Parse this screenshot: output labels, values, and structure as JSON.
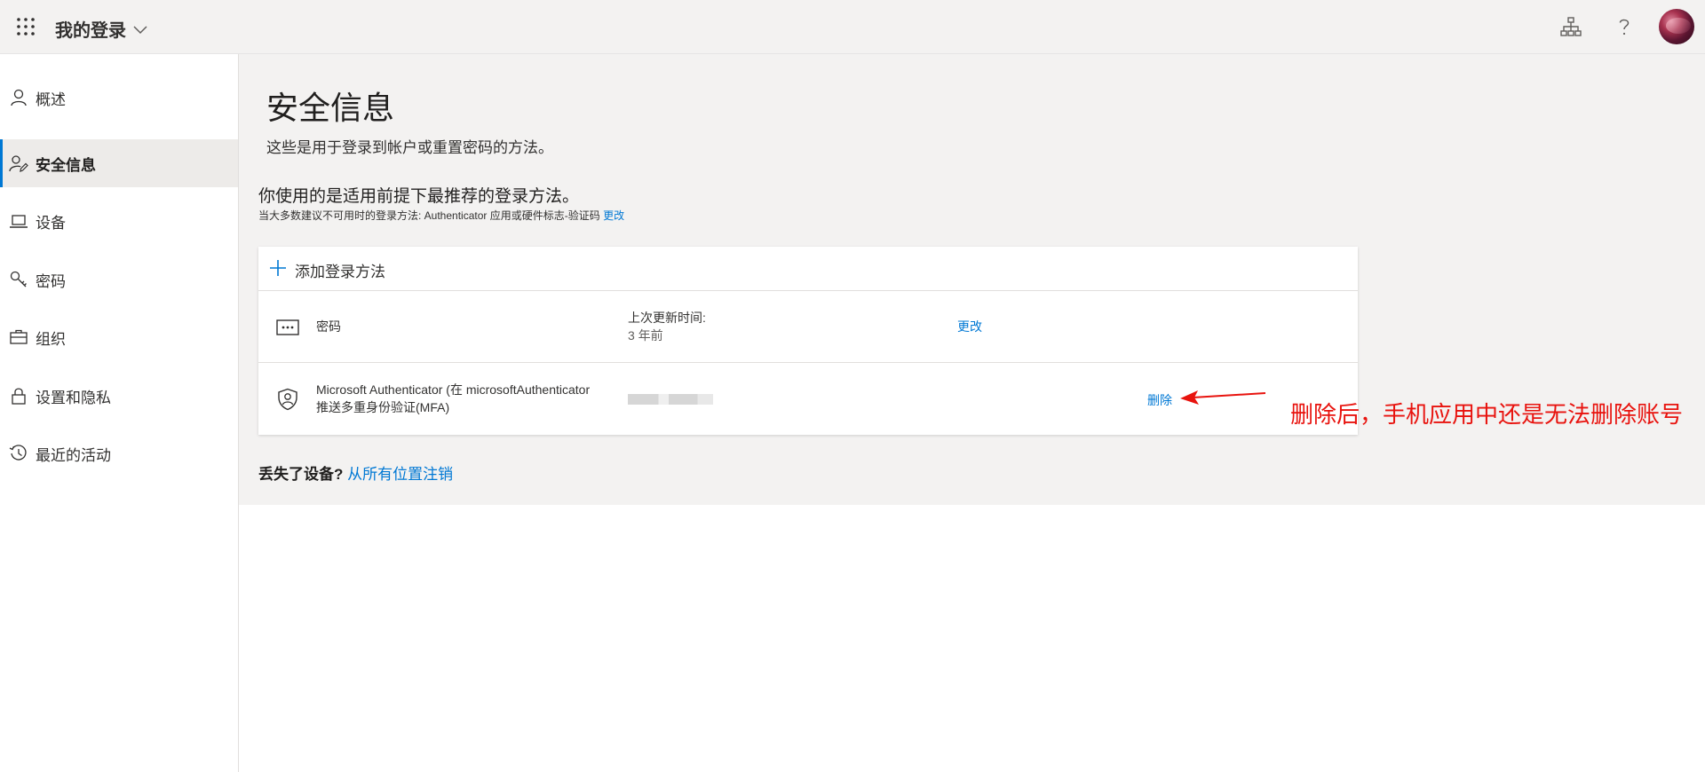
{
  "header": {
    "app_title": "我的登录",
    "icons": [
      "app-launcher-icon",
      "chevron-down-icon",
      "org-chart-icon",
      "help-icon",
      "avatar"
    ]
  },
  "sidebar": {
    "items": [
      {
        "label": "概述",
        "icon": "person-icon",
        "active": false
      },
      {
        "label": "安全信息",
        "icon": "person-edit-icon",
        "active": true
      },
      {
        "label": "设备",
        "icon": "laptop-icon",
        "active": false
      },
      {
        "label": "密码",
        "icon": "key-icon",
        "active": false
      },
      {
        "label": "组织",
        "icon": "briefcase-icon",
        "active": false
      },
      {
        "label": "设置和隐私",
        "icon": "lock-icon",
        "active": false
      },
      {
        "label": "最近的活动",
        "icon": "history-icon",
        "active": false
      }
    ]
  },
  "main": {
    "title": "安全信息",
    "subtitle": "这些是用于登录到帐户或重置密码的方法。",
    "recommendation_title": "你使用的是适用前提下最推荐的登录方法。",
    "recommendation_note": "当大多数建议不可用时的登录方法: Authenticator 应用或硬件标志-验证码",
    "recommendation_link": "更改",
    "add_method_label": "添加登录方法",
    "methods": [
      {
        "icon": "password-dots-icon",
        "name": "密码",
        "detail_label": "上次更新时间:",
        "detail_value": "3 年前",
        "action": "更改"
      },
      {
        "icon": "authenticator-icon",
        "name_line1": "Microsoft Authenticator (在 microsoftAuthenticator",
        "name_line2": "推送多重身份验证(MFA)",
        "detail_redacted": true,
        "action": "删除"
      }
    ],
    "lost_device_question": "丢失了设备?",
    "lost_device_link": "从所有位置注销"
  },
  "annotation": {
    "text": "删除后，手机应用中还是无法删除账号",
    "color": "#e8130e"
  },
  "colors": {
    "accent": "#0078d4",
    "background": "#f3f2f1"
  }
}
